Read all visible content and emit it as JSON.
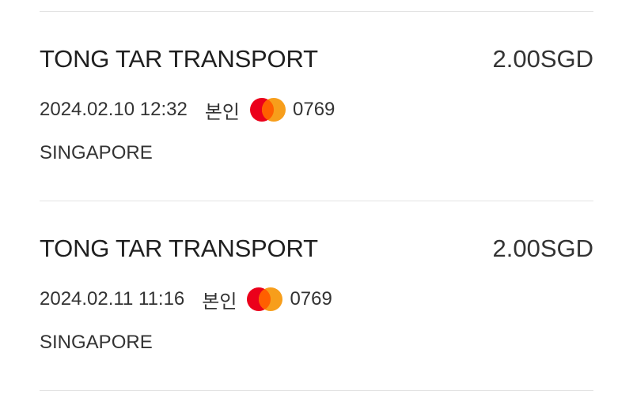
{
  "transactions": [
    {
      "merchant": "TONG TAR TRANSPORT",
      "amount": "2.00SGD",
      "datetime": "2024.02.10 12:32",
      "owner": "본인",
      "card_icon": "mastercard-icon",
      "card_last4": "0769",
      "location": "SINGAPORE"
    },
    {
      "merchant": "TONG TAR TRANSPORT",
      "amount": "2.00SGD",
      "datetime": "2024.02.11 11:16",
      "owner": "본인",
      "card_icon": "mastercard-icon",
      "card_last4": "0769",
      "location": "SINGAPORE"
    }
  ],
  "colors": {
    "mastercard_red": "#eb001b",
    "mastercard_orange": "#f79e1b",
    "divider": "#e3e3e3"
  }
}
